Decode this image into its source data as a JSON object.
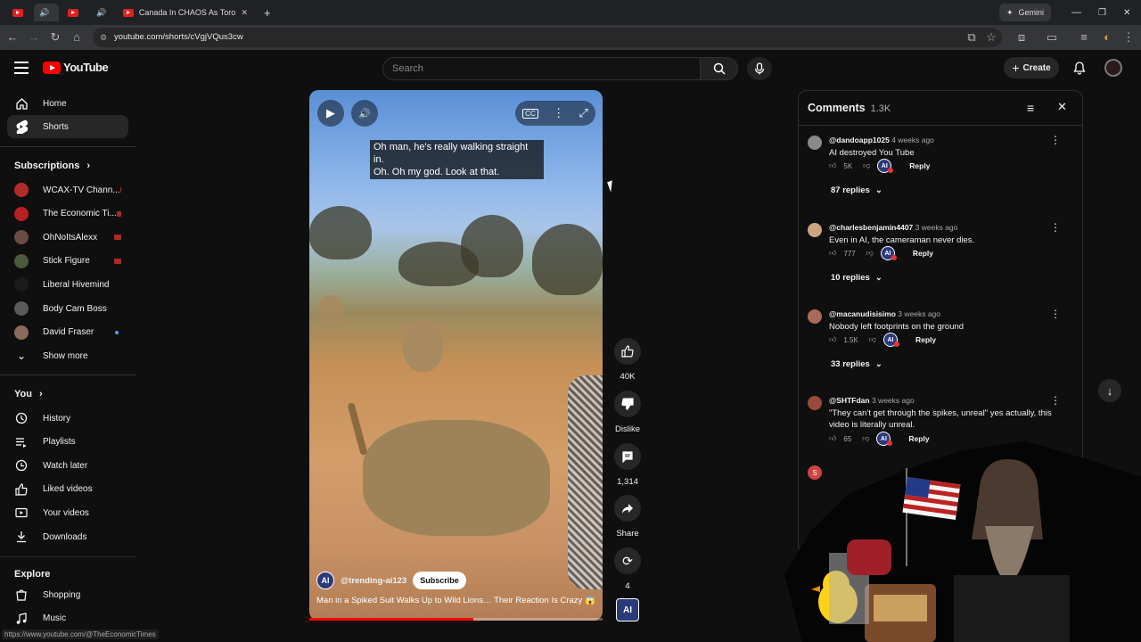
{
  "browser": {
    "tabs": [
      {
        "title": ""
      },
      {
        "title": ""
      },
      {
        "title": ""
      },
      {
        "title": ""
      },
      {
        "title": "Canada In CHAOS As Toronto M"
      }
    ],
    "url": "youtube.com/shorts/cVgjVQus3cw",
    "gemini_label": "Gemini"
  },
  "masthead": {
    "logo_text": "YouTube",
    "search_placeholder": "Search",
    "create_label": "Create"
  },
  "sidebar": {
    "main": [
      {
        "label": "Home",
        "icon": "home-icon"
      },
      {
        "label": "Shorts",
        "icon": "shorts-icon",
        "active": true
      }
    ],
    "subscriptions_heading": "Subscriptions",
    "subscriptions": [
      {
        "label": "WCAX-TV Chann...",
        "color": "#b32c2c",
        "live": true
      },
      {
        "label": "The Economic Ti...",
        "color": "#b82121",
        "live": true
      },
      {
        "label": "OhNoItsAlexx",
        "color": "#6b4c44",
        "live": true
      },
      {
        "label": "Stick Figure",
        "color": "#4a5a3a",
        "live": true
      },
      {
        "label": "Liberal Hivemind",
        "color": "#1a1a1a",
        "live": false
      },
      {
        "label": "Body Cam Boss",
        "color": "#5a5a5a",
        "live": false
      },
      {
        "label": "David Fraser",
        "color": "#8a6a5a",
        "dot": true
      }
    ],
    "show_more": "Show more",
    "you_heading": "You",
    "you_items": [
      {
        "label": "History",
        "icon": "history-icon"
      },
      {
        "label": "Playlists",
        "icon": "playlists-icon"
      },
      {
        "label": "Watch later",
        "icon": "watch-later-icon"
      },
      {
        "label": "Liked videos",
        "icon": "liked-videos-icon"
      },
      {
        "label": "Your videos",
        "icon": "your-videos-icon"
      },
      {
        "label": "Downloads",
        "icon": "downloads-icon"
      }
    ],
    "explore_heading": "Explore",
    "explore_items": [
      {
        "label": "Shopping",
        "icon": "shopping-icon"
      },
      {
        "label": "Music",
        "icon": "music-icon"
      }
    ]
  },
  "status_url": "https://www.youtube.com/@TheEconomicTimes",
  "video": {
    "caption_line1": "Oh man, he's really walking straight in.",
    "caption_line2": "Oh. Oh my god. Look at that.",
    "channel_badge": "AI",
    "channel": "@trending-ai123",
    "subscribe_label": "Subscribe",
    "title": "Man in a Spiked Suit Walks Up to Wild Lions… Their Reaction Is Crazy 😱🦁",
    "progress_fraction": 0.56
  },
  "actions": {
    "likes": "40K",
    "dislike_label": "Dislike",
    "comments_count": "1,314",
    "share_label": "Share",
    "remix_count": "4",
    "channel_badge": "AI"
  },
  "comments_panel": {
    "title": "Comments",
    "count": "1.3K",
    "items": [
      {
        "author": "@dandoapp1025",
        "time": "4 weeks ago",
        "text": "AI destroyed You Tube",
        "likes": "5K",
        "replies": "87 replies",
        "avatar_color": "#8a8a8a"
      },
      {
        "author": "@charlesbenjamin4407",
        "time": "3 weeks ago",
        "text": "Even in AI, the cameraman never dies.",
        "likes": "777",
        "replies": "10 replies",
        "avatar_color": "#c9a580"
      },
      {
        "author": "@macanudisisimo",
        "time": "3 weeks ago",
        "text": "Nobody left footprints on the ground",
        "likes": "1.5K",
        "replies": "33 replies",
        "avatar_color": "#a86b5a"
      },
      {
        "author": "@SHTFdan",
        "time": "3 weeks ago",
        "text": "\"They can't get through the spikes, unreal\" yes actually, this video is literally unreal.",
        "likes": "65",
        "replies": "",
        "avatar_color": "#9a4a3a"
      }
    ],
    "reply_label": "Reply",
    "partial_avatar_letter": "S"
  }
}
